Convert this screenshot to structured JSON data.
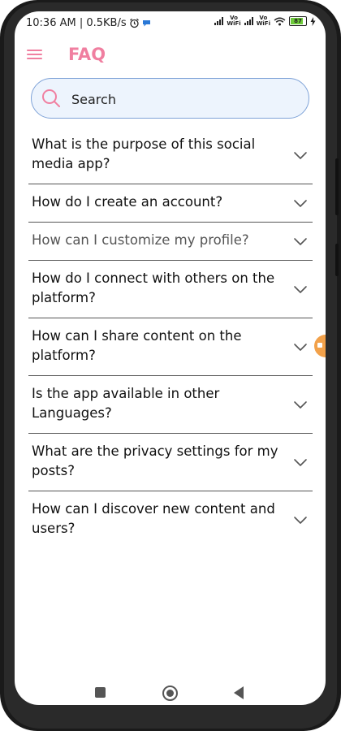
{
  "status_bar": {
    "time_speed": "10:36 AM | 0.5KB/s",
    "alarm_icon": "alarm-icon",
    "msg_icon": "message-bubble-icon",
    "vowifi_1": "Vo\nWiFi",
    "vowifi_2": "Vo\nWiFi",
    "battery": "87"
  },
  "app_bar": {
    "title": "FAQ",
    "menu_icon": "hamburger-menu-icon"
  },
  "search": {
    "placeholder": "Search"
  },
  "faqs": [
    {
      "question": "What is the purpose of this social media app?"
    },
    {
      "question": "How do I create an account?"
    },
    {
      "question": "How can I customize my profile?"
    },
    {
      "question": "How do I connect with others on the platform?"
    },
    {
      "question": "How can I share content on the platform?"
    },
    {
      "question": "Is the app available in other Languages?"
    },
    {
      "question": "What are the privacy settings for my posts?"
    },
    {
      "question": "How can I discover new content and users?"
    }
  ],
  "colors": {
    "accent": "#f07fa0",
    "search_bg": "#edf4fd",
    "search_border": "#7fa3d8",
    "divider": "#555555"
  }
}
